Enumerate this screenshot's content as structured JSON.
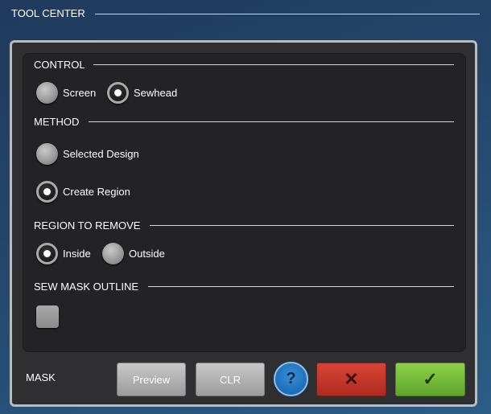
{
  "header": {
    "title": "TOOL CENTER"
  },
  "control": {
    "heading": "CONTROL",
    "options": [
      {
        "label": "Screen",
        "checked": false
      },
      {
        "label": "Sewhead",
        "checked": true
      }
    ]
  },
  "method": {
    "heading": "METHOD",
    "options": [
      {
        "label": "Selected Design",
        "checked": false
      },
      {
        "label": "Create Region",
        "checked": true
      }
    ]
  },
  "region": {
    "heading": "REGION TO REMOVE",
    "options": [
      {
        "label": "Inside",
        "checked": true
      },
      {
        "label": "Outside",
        "checked": false
      }
    ]
  },
  "outline": {
    "heading": "SEW MASK OUTLINE",
    "checked": false
  },
  "footer": {
    "mode_label": "MASK",
    "preview_label": "Preview",
    "clear_label": "CLR",
    "help_glyph": "?",
    "cancel_glyph": "✕",
    "ok_glyph": "✓"
  },
  "colors": {
    "cancel": "#c53628",
    "ok": "#76bb38",
    "help": "#1d6db8"
  },
  "icons": {
    "help": "question-icon",
    "cancel": "close-icon",
    "ok": "check-icon"
  }
}
